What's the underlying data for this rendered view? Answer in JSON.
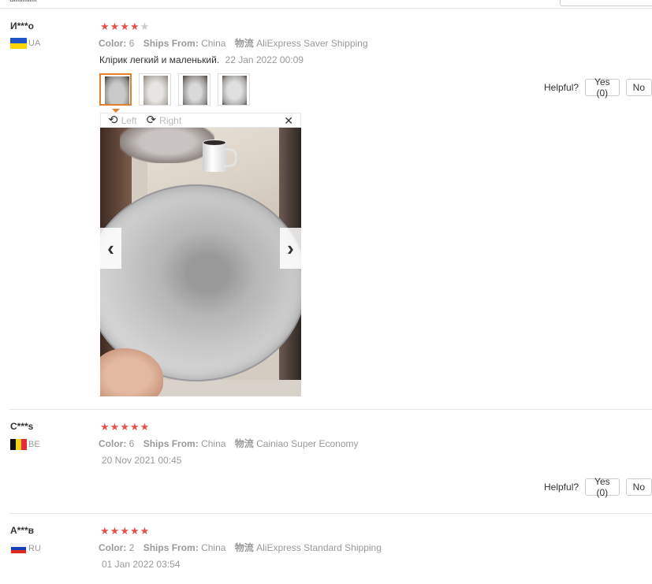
{
  "top": {
    "hint_text": "ulllllllllllll"
  },
  "labels": {
    "color": "Color:",
    "ships_from": "Ships From:",
    "logistics": "物流",
    "helpful": "Helpful?"
  },
  "reviews": [
    {
      "user": "И***о",
      "country": "UA",
      "stars": 4,
      "color": "6",
      "ships_from": "China",
      "shipping": "AliExpress Saver Shipping",
      "text": "Клірик легкий и маленький.",
      "date": "22 Jan 2022 00:09",
      "yes": "Yes (0)",
      "no": "No"
    },
    {
      "user": "C***s",
      "country": "BE",
      "stars": 5,
      "color": "6",
      "ships_from": "China",
      "shipping": "Cainiao Super Economy",
      "date": "20 Nov 2021 00:45",
      "yes": "Yes (0)",
      "no": "No"
    },
    {
      "user": "A***в",
      "country": "RU",
      "stars": 5,
      "color": "2",
      "ships_from": "China",
      "shipping": "AliExpress Standard Shipping",
      "date": "01 Jan 2022 03:54"
    }
  ],
  "viewer": {
    "rotate_left": "Left",
    "rotate_right": "Right",
    "icons": {
      "rotate_left": "rotate-left-icon",
      "rotate_right": "rotate-right-icon",
      "close": "close-icon",
      "prev": "chevron-left-icon",
      "next": "chevron-right-icon"
    }
  },
  "colors": {
    "star": "#e2524f",
    "active_thumb": "#e0812a",
    "muted": "#999999"
  }
}
